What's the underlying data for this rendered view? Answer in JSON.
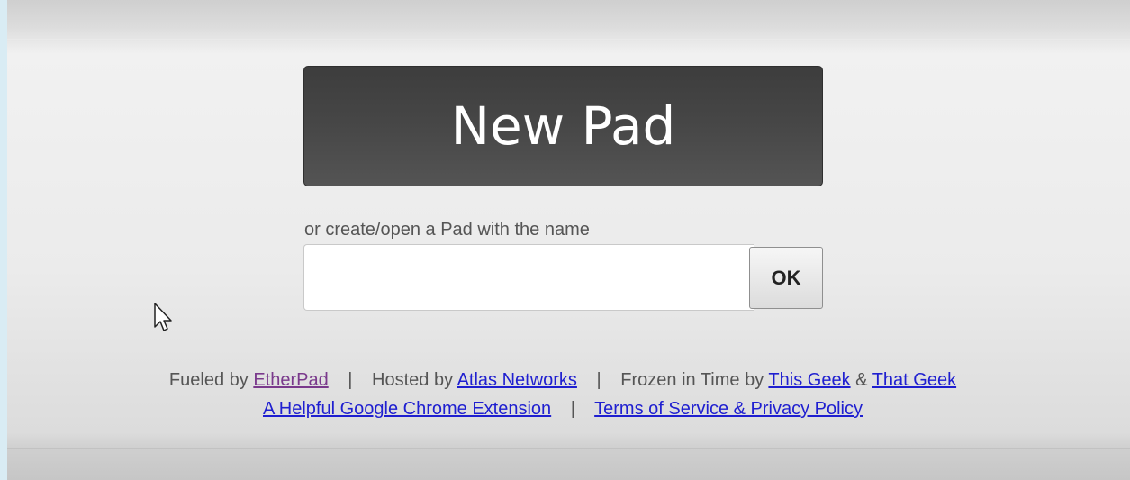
{
  "main": {
    "new_pad_label": "New Pad",
    "prompt": "or create/open a Pad with the name",
    "name_input": {
      "value": "",
      "placeholder": ""
    },
    "ok_label": "OK"
  },
  "footer": {
    "line1": {
      "fueled_prefix": "Fueled by",
      "etherpad_link": "EtherPad",
      "separator": "|",
      "hosted_prefix": "Hosted by",
      "atlas_link": "Atlas Networks",
      "frozen_prefix": "Frozen in Time by",
      "this_geek_link": "This Geek",
      "ampersand": "&",
      "that_geek_link": "That Geek"
    },
    "line2": {
      "chrome_extension_link": "A Helpful Google Chrome Extension",
      "separator": "|",
      "terms_link": "Terms of Service & Privacy Policy"
    }
  },
  "colors": {
    "link": "#1f1fd0",
    "visited_link": "#7a3a8c",
    "button_dark": "#474747",
    "text": "#555555"
  },
  "icons": {
    "cursor": "mouse-pointer-icon"
  }
}
